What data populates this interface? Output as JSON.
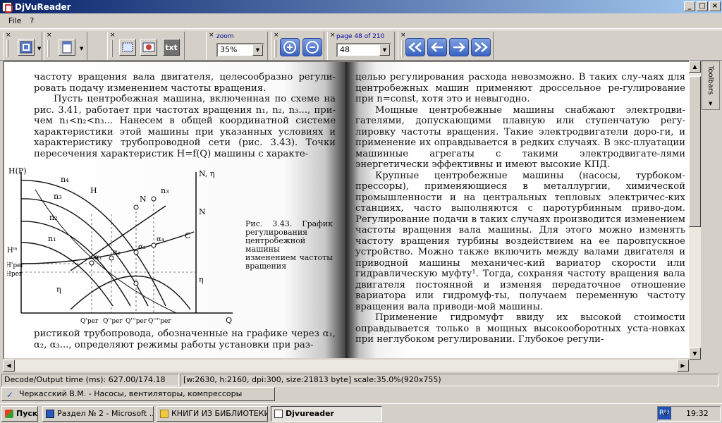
{
  "window": {
    "title": "DjVuReader",
    "min_label": "_",
    "max_label": "□",
    "close_label": "×"
  },
  "menu": {
    "file": "File",
    "help": "?"
  },
  "toolbar": {
    "zoom_label": "zoom",
    "zoom_value": "35%",
    "page_label": "page 48 of 210",
    "page_value": "48",
    "txt_label": "txt",
    "close_mark": "×"
  },
  "page_left": {
    "para1": "частоту вращения вала двигателя, целесообразно регули-ровать подачу изменением частоты вращения.",
    "para2": "Пусть центробежная машина, включенная по схеме на рис. 3.41, работает при частотах вращения n₁, n₂, n₃..., при-чем n₁<n₂<n₃... Нанесем в общей координатной системе характеристики этой машины при указанных условиях и характеристику трубопроводной сети (рис. 3.43). Точки пересечения характеристик H=f(Q) машины с характе-",
    "para3": "ристикой трубопровода, обозначенные на графике через α₁, α₂, α₃..., определяют режимы работы установки при раз-"
  },
  "figure": {
    "caption": "Рис. 3.43. График регулирования центробежной машины изменением частоты вращения",
    "y_left": "H(P)",
    "y_right": "N, η",
    "x_axis": "Q",
    "label_n4": "n₄",
    "label_n3": "n₃",
    "label_n2": "n₂",
    "label_n1": "n₁",
    "label_H": "H",
    "label_N": "N",
    "label_N_right": "N",
    "label_C": "C",
    "label_eta": "η",
    "label_eta_right": "η",
    "label_Hm": "Hᵐ",
    "label_Hpeg": "H'рег",
    "label_Hpeg2": "Hрег",
    "label_a1": "α₁",
    "label_a2": "α₂",
    "label_a3": "α₃",
    "label_a4": "α₄",
    "label_nj": "n₃",
    "q1": "Q'рег",
    "q2": "Q''рег",
    "q3": "Q'''рег",
    "q4": "Q''''рег"
  },
  "page_right": {
    "para1": "целью регулирования расхода невозможно. В таких слу-чаях для центробежных машин применяют дроссельное ре-гулирование при n=const, хотя это и невыгодно.",
    "para2": "Мощные центробежные машины снабжают электродви-гателями, допускающими плавную или ступенчатую регу-лировку частоты вращения. Такие электродвигатели доро-ги, и применение их оправдывается в редких случаях. В экс-плуатации машинные агрегаты с такими электродвигате-лями энергетически эффективны и имеют высокие КПД.",
    "para3": "Крупные центробежные машины (насосы, турбоком-прессоры), применяющиеся в металлургии, химической промышленности и на центральных тепловых электричес-ких станциях, часто выполняются с паротурбинным приво-дом. Регулирование подачи в таких случаях производится изменением частоты вращения вала машины. Для этого можно изменять частоту вращения турбины воздействием на ее паровпускное устройство. Можно также включить между валами двигателя и приводной машины механичес-кий вариатор скорости или гидравлическую муфту¹. Тогда, сохраняя частоту вращения вала двигателя постоянной и изменяя передаточное отношение вариатора или гидромуф-ты, получаем переменную частоту вращения вала приводи-мой машины.",
    "para4": "Применение гидромуфт ввиду их высокой стоимости оправдывается только в мощных высокооборотных уста-новках при неглубоком регулировании. Глубокое регули-"
  },
  "side_panel": {
    "label": "Toolbars"
  },
  "status": {
    "decode": "Decode/Output time (ms): 627.00/174.18",
    "info": "[w:2630, h:2160, dpi:300, size:21813 byte] scale:35.0%(920x755)"
  },
  "doc_tab": {
    "label": "Черкасский В.М. - Насосы, вентиляторы, компрессоры Учебник.djvu"
  },
  "taskbar": {
    "start": "Пуск",
    "task1": "Раздел № 2 - Microsoft ...",
    "task2": "КНИГИ ИЗ БИБЛИОТЕКИ",
    "task3": "Djvureader",
    "lang": "RU",
    "arrows": "«",
    "clock": "19:32"
  }
}
